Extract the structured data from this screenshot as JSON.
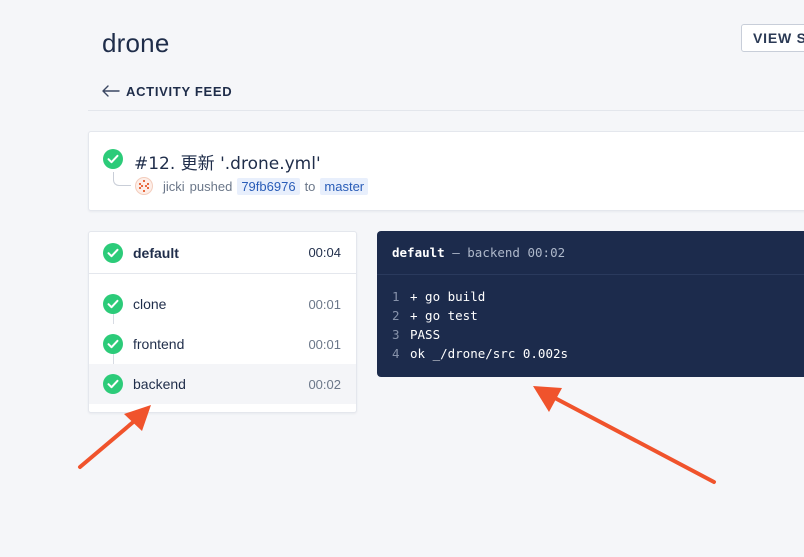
{
  "header": {
    "repo_name": "drone",
    "view_button": "VIEW SOURCE",
    "back_link": "ACTIVITY FEED"
  },
  "build": {
    "title": "#12. 更新 '.drone.yml'",
    "author": "jicki",
    "action": "pushed",
    "commit": "79fb6976",
    "to": "to",
    "branch": "master",
    "status_color": "#2ccb79"
  },
  "stage": {
    "name": "default",
    "duration": "00:04",
    "steps": [
      {
        "name": "clone",
        "duration": "00:01"
      },
      {
        "name": "frontend",
        "duration": "00:01"
      },
      {
        "name": "backend",
        "duration": "00:02"
      }
    ]
  },
  "log": {
    "stage": "default",
    "separator": "—",
    "step": "backend",
    "duration": "00:02",
    "lines": [
      {
        "n": "1",
        "text": "+ go build"
      },
      {
        "n": "2",
        "text": "+ go test"
      },
      {
        "n": "3",
        "text": "PASS"
      },
      {
        "n": "4",
        "text": "ok _/drone/src 0.002s"
      }
    ]
  },
  "colors": {
    "success": "#2ccb79",
    "log_background": "#1c2b4c",
    "annotation_arrow": "#f0532c"
  },
  "icons": [
    "check-circle-icon",
    "arrow-left-icon",
    "avatar-icon"
  ]
}
